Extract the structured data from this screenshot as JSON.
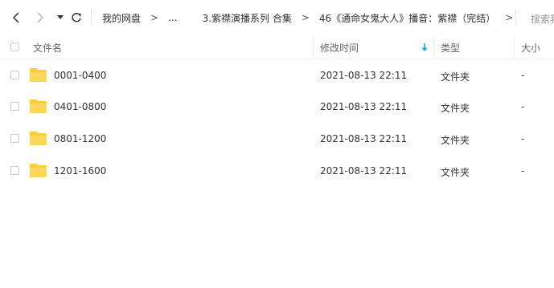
{
  "toolbar": {
    "back_icon": "chevron-left-icon",
    "forward_icon": "chevron-right-icon",
    "history_icon": "caret-down-icon",
    "refresh_icon": "refresh-icon",
    "breadcrumbs": [
      "我的网盘",
      "...",
      "3.紫襟演播系列 合集",
      "46《通命女鬼大人》播音：紫襟（完结）"
    ],
    "crumb_separator": ">",
    "search_placeholder": "搜索我"
  },
  "table": {
    "columns": {
      "name": "文件名",
      "modified": "修改时间",
      "type": "类型",
      "size": "大小"
    },
    "sort_icon": "arrow-down-icon",
    "rows": [
      {
        "name": "0001-0400",
        "modified": "2021-08-13 22:11",
        "type": "文件夹",
        "size": "-"
      },
      {
        "name": "0401-0800",
        "modified": "2021-08-13 22:11",
        "type": "文件夹",
        "size": "-"
      },
      {
        "name": "0801-1200",
        "modified": "2021-08-13 22:11",
        "type": "文件夹",
        "size": "-"
      },
      {
        "name": "1201-1600",
        "modified": "2021-08-13 22:11",
        "type": "文件夹",
        "size": "-"
      }
    ]
  },
  "colors": {
    "folder": "#ffcb3d",
    "sort_arrow": "#06a7ff",
    "text": "#333333",
    "muted": "#999999"
  }
}
